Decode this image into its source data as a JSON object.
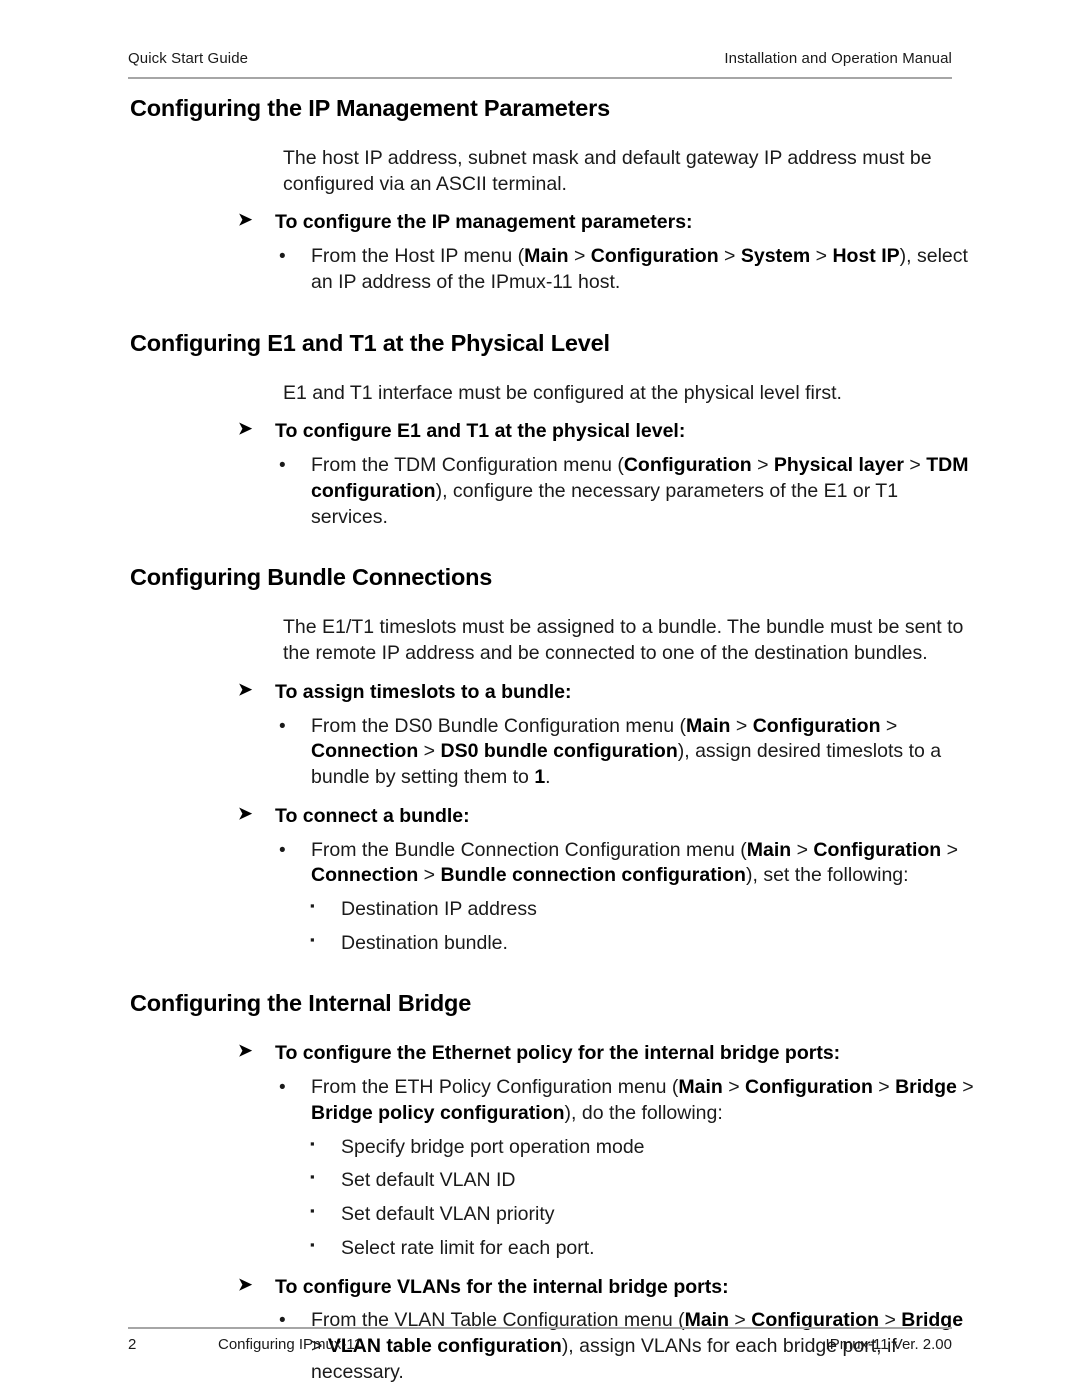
{
  "header": {
    "left": "Quick Start Guide",
    "right": "Installation and Operation Manual"
  },
  "footer": {
    "page_number": "2",
    "section": "Configuring IPmux-11",
    "version": "IPmux-11 Ver. 2.00"
  },
  "icons": {
    "arrow_bullet": "➤",
    "round_bullet": "•",
    "square_bullet": "▪"
  },
  "sections": [
    {
      "title": "Configuring the IP Management Parameters",
      "intro": "The host IP address, subnet mask and default gateway IP address must be configured via an ASCII terminal.",
      "procedures": [
        {
          "heading": "To configure the IP management parameters:",
          "steps": [
            {
              "parts": [
                {
                  "text": "From the Host IP menu (",
                  "bold": false
                },
                {
                  "text": "Main",
                  "bold": true
                },
                {
                  "text": " > ",
                  "bold": false
                },
                {
                  "text": "Configuration",
                  "bold": true
                },
                {
                  "text": " > ",
                  "bold": false
                },
                {
                  "text": "System",
                  "bold": true
                },
                {
                  "text": " > ",
                  "bold": false
                },
                {
                  "text": "Host IP",
                  "bold": true
                },
                {
                  "text": "), select an IP address of the IPmux-11 host.",
                  "bold": false
                }
              ],
              "subitems": []
            }
          ]
        }
      ]
    },
    {
      "title": "Configuring E1 and T1 at the Physical Level",
      "intro": "E1 and T1 interface must be configured at the physical level first.",
      "procedures": [
        {
          "heading": "To configure E1 and T1 at the physical level:",
          "steps": [
            {
              "parts": [
                {
                  "text": "From the TDM Configuration menu (",
                  "bold": false
                },
                {
                  "text": "Configuration",
                  "bold": true
                },
                {
                  "text": " > ",
                  "bold": false
                },
                {
                  "text": "Physical layer",
                  "bold": true
                },
                {
                  "text": " > ",
                  "bold": false
                },
                {
                  "text": "TDM configuration",
                  "bold": true
                },
                {
                  "text": "), configure the necessary parameters of the E1 or T1 services.",
                  "bold": false
                }
              ],
              "subitems": []
            }
          ]
        }
      ]
    },
    {
      "title": "Configuring Bundle Connections",
      "intro": "The E1/T1 timeslots must be assigned to a bundle. The bundle must be sent to the remote IP address and be connected to one of the destination bundles.",
      "procedures": [
        {
          "heading": "To assign timeslots to a bundle:",
          "steps": [
            {
              "parts": [
                {
                  "text": "From the DS0 Bundle Configuration menu (",
                  "bold": false
                },
                {
                  "text": "Main",
                  "bold": true
                },
                {
                  "text": " > ",
                  "bold": false
                },
                {
                  "text": "Configuration",
                  "bold": true
                },
                {
                  "text": " > ",
                  "bold": false
                },
                {
                  "text": "Connection",
                  "bold": true
                },
                {
                  "text": " > ",
                  "bold": false
                },
                {
                  "text": "DS0 bundle configuration",
                  "bold": true
                },
                {
                  "text": "), assign desired timeslots to a bundle by setting them to ",
                  "bold": false
                },
                {
                  "text": "1",
                  "bold": true
                },
                {
                  "text": ".",
                  "bold": false
                }
              ],
              "subitems": []
            }
          ]
        },
        {
          "heading": "To connect a bundle:",
          "steps": [
            {
              "parts": [
                {
                  "text": "From the Bundle Connection Configuration menu (",
                  "bold": false
                },
                {
                  "text": "Main",
                  "bold": true
                },
                {
                  "text": " > ",
                  "bold": false
                },
                {
                  "text": "Configuration",
                  "bold": true
                },
                {
                  "text": " > ",
                  "bold": false
                },
                {
                  "text": "Connection",
                  "bold": true
                },
                {
                  "text": " > ",
                  "bold": false
                },
                {
                  "text": "Bundle connection configuration",
                  "bold": true
                },
                {
                  "text": "), set the following:",
                  "bold": false
                }
              ],
              "subitems": [
                "Destination IP address",
                "Destination bundle."
              ]
            }
          ]
        }
      ]
    },
    {
      "title": "Configuring the Internal Bridge",
      "intro": null,
      "procedures": [
        {
          "heading": "To configure the Ethernet policy for the internal bridge ports:",
          "steps": [
            {
              "parts": [
                {
                  "text": "From the ETH Policy Configuration menu (",
                  "bold": false
                },
                {
                  "text": "Main",
                  "bold": true
                },
                {
                  "text": " > ",
                  "bold": false
                },
                {
                  "text": "Configuration",
                  "bold": true
                },
                {
                  "text": " > ",
                  "bold": false
                },
                {
                  "text": "Bridge",
                  "bold": true
                },
                {
                  "text": " > ",
                  "bold": false
                },
                {
                  "text": "Bridge policy configuration",
                  "bold": true
                },
                {
                  "text": "), do the following:",
                  "bold": false
                }
              ],
              "subitems": [
                "Specify bridge port operation mode",
                "Set default VLAN ID",
                "Set default VLAN priority",
                "Select rate limit for each port."
              ]
            }
          ]
        },
        {
          "heading": "To configure VLANs for the internal bridge ports:",
          "steps": [
            {
              "parts": [
                {
                  "text": "From the VLAN Table Configuration menu (",
                  "bold": false
                },
                {
                  "text": "Main",
                  "bold": true
                },
                {
                  "text": " > ",
                  "bold": false
                },
                {
                  "text": "Configuration",
                  "bold": true
                },
                {
                  "text": " > ",
                  "bold": false
                },
                {
                  "text": "Bridge",
                  "bold": true
                },
                {
                  "text": " > ",
                  "bold": false
                },
                {
                  "text": "VLAN table configuration",
                  "bold": true
                },
                {
                  "text": "), assign VLANs for each bridge port, if necessary.",
                  "bold": false
                }
              ],
              "subitems": []
            }
          ]
        }
      ]
    }
  ]
}
